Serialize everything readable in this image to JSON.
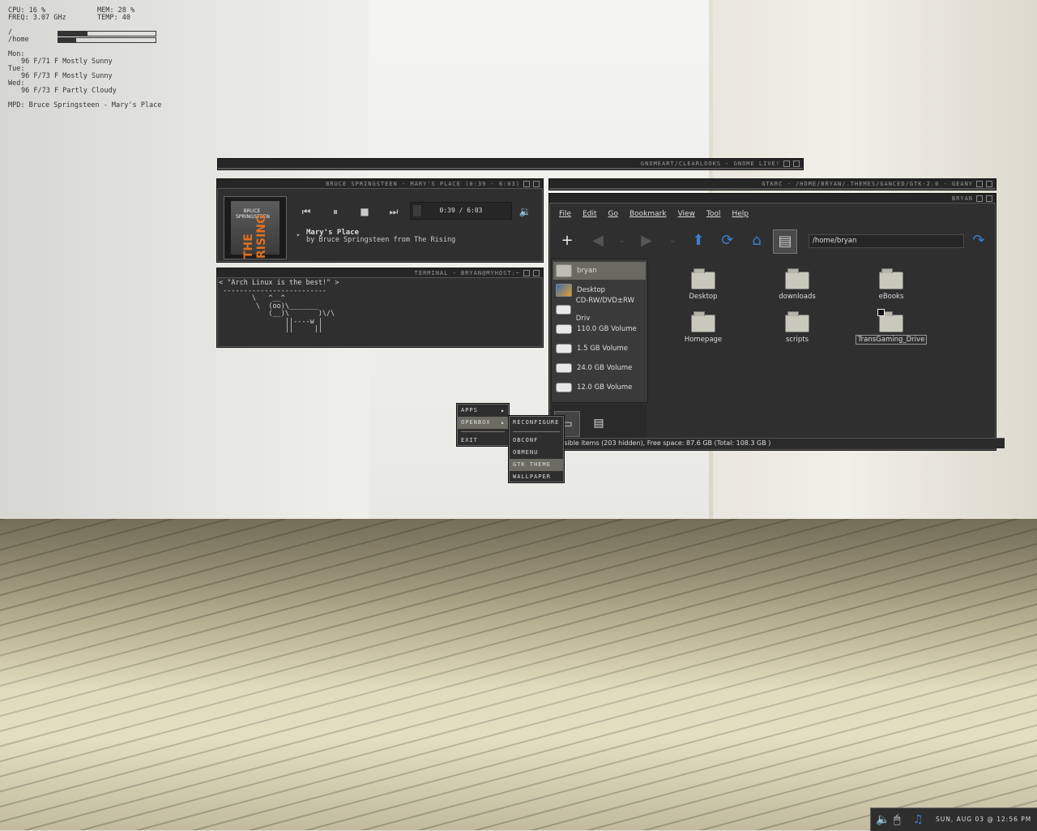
{
  "conky": {
    "cpu": "CPU: 16 %",
    "mem": "MEM: 28 %",
    "freq": "FREQ: 3.07 GHz",
    "temp": "TEMP: 40",
    "root_label": "/",
    "root_usage": 0.3,
    "home_label": "/home",
    "home_usage": 0.18,
    "weather": [
      {
        "day": "Mon:",
        "forecast": "96 F/71 F Mostly Sunny"
      },
      {
        "day": "Tue:",
        "forecast": "96 F/73 F Mostly Sunny"
      },
      {
        "day": "Wed:",
        "forecast": "96 F/73 F Partly Cloudy"
      }
    ],
    "mpd": "MPD: Bruce Springsteen - Mary's Place"
  },
  "windows": {
    "gnome_art_title": "GNOMEART/CLEARLOOKS - GNOME LIVE!",
    "player_title": "BRUCE SPRINGSTEEN - MARY'S PLACE (0:39 - 6:03)",
    "terminal_title": "TERMINAL - BRYAN@MYHOST:~",
    "geany_title": "GTKRC - /HOME/BRYAN/.THEMES/GANCED/GTK-2.0 - GEANY",
    "fm_title": "BRYAN"
  },
  "player": {
    "album_art_artist": "BRUCE SPRINGSTEEN",
    "album_art_title": "THE RISING",
    "time": "0:39 / 6:03",
    "song": "Mary's Place",
    "byline": "by Bruce Springsteen from The Rising"
  },
  "terminal": {
    "output": "< \"Arch Linux is the best!\" >\n -------------------------\n        \\   ^__^\n         \\  (oo)\\_______\n            (__)\\       )\\/\\\n                ||----w |\n                ||     ||"
  },
  "filemanager": {
    "menu": [
      "File",
      "Edit",
      "Go",
      "Bookmark",
      "View",
      "Tool",
      "Help"
    ],
    "path": "/home/bryan",
    "side_items": [
      {
        "label": "bryan",
        "icon": "home-icon",
        "selected": true
      },
      {
        "label": "Desktop",
        "icon": "desktop-icon",
        "selected": false
      },
      {
        "label": "CD-RW/DVD±RW Driv",
        "icon": "drive-icon",
        "selected": false
      },
      {
        "label": "110.0 GB Volume",
        "icon": "drive-icon",
        "selected": false
      },
      {
        "label": "1.5 GB Volume",
        "icon": "drive-icon",
        "selected": false
      },
      {
        "label": "24.0 GB Volume",
        "icon": "drive-icon",
        "selected": false
      },
      {
        "label": "12.0 GB Volume",
        "icon": "drive-icon",
        "selected": false
      }
    ],
    "folders": [
      "Desktop",
      "downloads",
      "eBooks",
      "Homepage",
      "scripts",
      "TransGaming_Drive"
    ],
    "status": "isible items (203 hidden), Free space: 87.6 GB (Total: 108.3 GB )"
  },
  "openbox_menu": {
    "root": [
      "APPS",
      "OPENBOX",
      "EXIT"
    ],
    "submenu": [
      "RECONFIGURE",
      "OBCONF",
      "OBMENU",
      "GTK THEME",
      "WALLPAPER"
    ]
  },
  "tray": {
    "clock": "SUN, AUG 03 @ 12:56 PM"
  }
}
